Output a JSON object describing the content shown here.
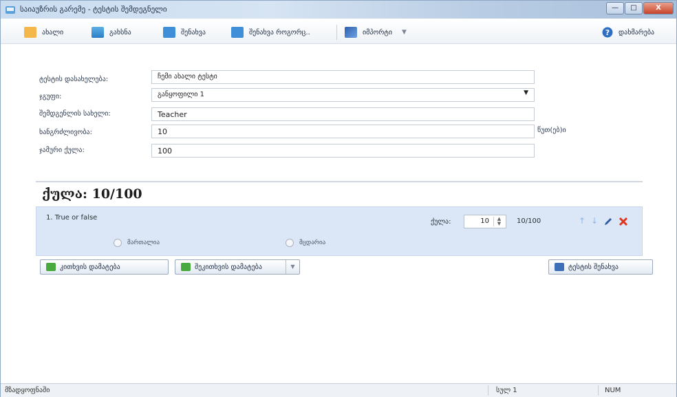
{
  "window": {
    "title": "საიაუზრის გარემე - ტესტის შემდეგნელი",
    "buttons": {
      "minimize": "—",
      "maximize": "□",
      "close": "X"
    }
  },
  "toolbar": {
    "new_label": "ახალი",
    "open_label": "გახსნა",
    "save_label": "შენახვა",
    "save_as_label": "შენახვა როგორც..",
    "export_label": "იმპორტი",
    "help_label": "დახმარება"
  },
  "form": {
    "test_name_label": "ტესტის დასახელება:",
    "test_name_value": "ჩემი ახალი ტესტი",
    "group_label": "ჯგუფი:",
    "group_value": "განყოფილი 1",
    "author_label": "შემდგენლის სახელი:",
    "author_value": "Teacher",
    "duration_label": "ხანგრძლივობა:",
    "duration_value": "10",
    "duration_unit": "წუთ(ებ)ი",
    "max_score_label": "ჯამური ქულა:",
    "max_score_value": "100"
  },
  "score_summary": "ქულა: 10/100",
  "question": {
    "title": "1. True or false",
    "score_label": "ქულა:",
    "score_value": "10",
    "score_total": "10/100",
    "option_true": "მართალია",
    "option_false": "მცდარია"
  },
  "buttons": {
    "add_question": "კითხვის დამატება",
    "add_answer": "შეკითხვის დამატება",
    "save_test": "ტესტის შენახვა"
  },
  "statusbar": {
    "state": "მზადყოფნაში",
    "page": "სულ 1",
    "num": "NUM"
  }
}
